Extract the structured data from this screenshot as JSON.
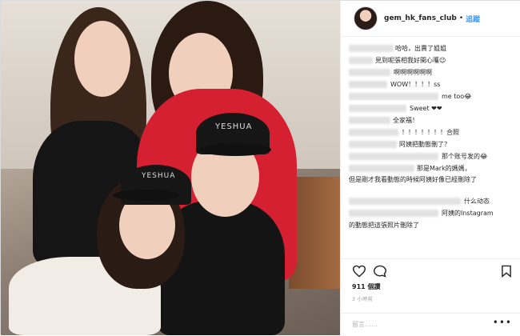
{
  "header": {
    "username": "gem_hk_fans_club",
    "separator": "•",
    "follow_label": "追蹤"
  },
  "photo": {
    "cap_text_1": "YESHUA",
    "cap_text_2": "YESHUA"
  },
  "comments": [
    {
      "text": "哈哈，出賣了姐姐"
    },
    {
      "text": "見到呢張相我好開心嚄😉"
    },
    {
      "text": "啊啊啊啊啊啊"
    },
    {
      "text": "WOW！！！！ss"
    },
    {
      "text": "me too😂"
    },
    {
      "text": "Sweet ❤❤"
    },
    {
      "text": "全家福！"
    },
    {
      "text": "！！！！！！！合照"
    },
    {
      "text": "阿姨把動態刪了？"
    },
    {
      "text": "那个账号发的😂"
    },
    {
      "text": "那是Mark的媽媽，"
    },
    {
      "text": "但是剛才我看動態的時候阿姨好像已經刪除了"
    },
    {
      "text": "什么动态"
    },
    {
      "text": "阿姨的Instagram"
    },
    {
      "text": "的動態把這張照片刪除了"
    }
  ],
  "actions": {
    "likes": "911 個讚",
    "time": "3 小時前",
    "add_comment_placeholder": "留言……",
    "more": "•••"
  },
  "icons": [
    "heart-icon",
    "comment-icon",
    "bookmark-icon",
    "more-icon"
  ]
}
